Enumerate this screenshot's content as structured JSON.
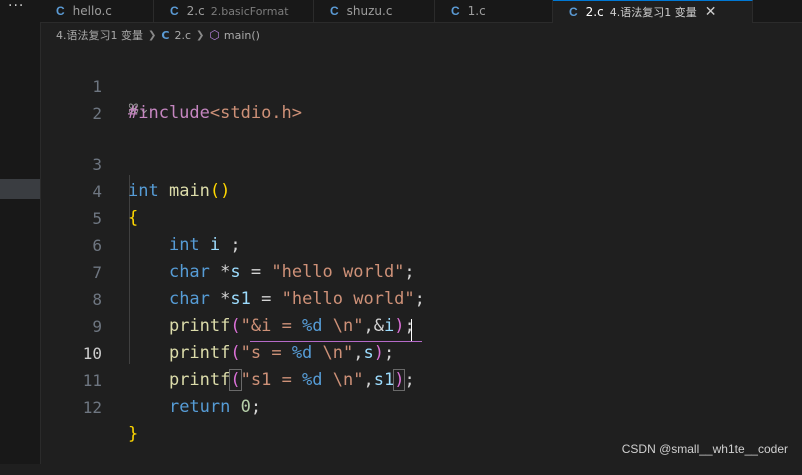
{
  "activity": {
    "more": "···"
  },
  "tabs": [
    {
      "icon": "C",
      "name": "hello.c",
      "desc": "",
      "active": false
    },
    {
      "icon": "C",
      "name": "2.c",
      "desc": "2.basicFormat",
      "active": false
    },
    {
      "icon": "C",
      "name": "shuzu.c",
      "desc": "",
      "active": false
    },
    {
      "icon": "C",
      "name": "1.c",
      "desc": "",
      "active": false
    },
    {
      "icon": "C",
      "name": "2.c",
      "desc": "4.语法复习1 变量",
      "active": true,
      "close": "✕"
    }
  ],
  "breadcrumb": {
    "folder": "4.语法复习1 变量",
    "file_icon": "C",
    "file": "2.c",
    "symbol": "main()"
  },
  "editor": {
    "current_line": 10,
    "lens": "ꕤ⌄",
    "lines": {
      "1": {
        "num": "1",
        "t": [
          "#include",
          "<stdio.h>"
        ]
      },
      "2": {
        "num": "2"
      },
      "3": {
        "num": "3",
        "t": [
          "int",
          " ",
          "main",
          "(",
          ")"
        ]
      },
      "4": {
        "num": "4",
        "t": [
          "{"
        ]
      },
      "5": {
        "num": "5",
        "t": [
          "    ",
          "int",
          " ",
          "i",
          " ;"
        ]
      },
      "6": {
        "num": "6",
        "t": [
          "    ",
          "char",
          " *",
          "s",
          " = ",
          "\"hello world\"",
          ";"
        ]
      },
      "7": {
        "num": "7",
        "t": [
          "    ",
          "char",
          " *",
          "s1",
          " = ",
          "\"hello world\"",
          ";"
        ]
      },
      "8": {
        "num": "8",
        "t": [
          "    ",
          "printf",
          "(",
          "\"&i = ",
          "%d",
          " \\n\"",
          ",&",
          "i",
          ")",
          ";"
        ]
      },
      "9": {
        "num": "9",
        "t": [
          "    ",
          "printf",
          "(",
          "\"s = ",
          "%d",
          " \\n\"",
          ",",
          "s",
          ")",
          ";"
        ]
      },
      "10": {
        "num": "10",
        "t": [
          "    ",
          "printf",
          "(",
          "\"s1 = ",
          "%d",
          " \\n\"",
          ",",
          "s1",
          ")",
          ";"
        ]
      },
      "11": {
        "num": "11",
        "t": [
          "    ",
          "return",
          " ",
          "0",
          ";"
        ]
      },
      "12": {
        "num": "12",
        "t": [
          "}"
        ]
      }
    }
  },
  "watermark": "CSDN @small__wh1te__coder"
}
